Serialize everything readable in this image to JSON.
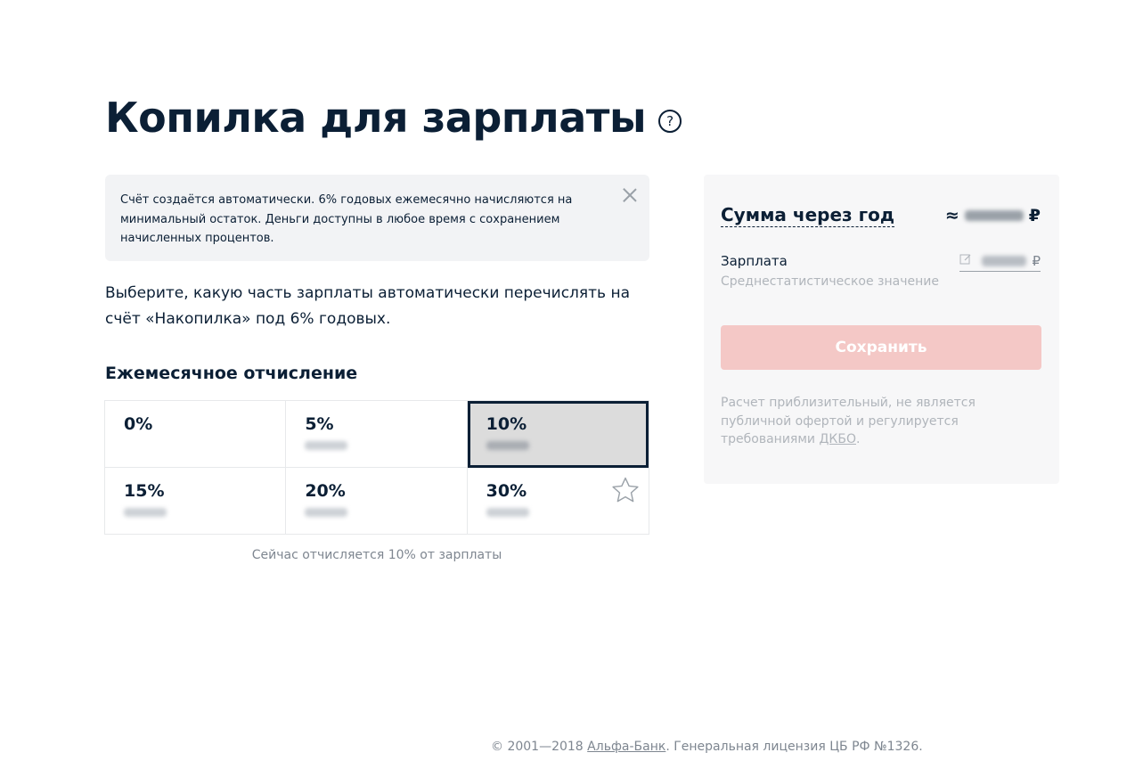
{
  "page": {
    "title": "Копилка для зарплаты",
    "help_icon": "question-circle-icon",
    "help_glyph": "?"
  },
  "notice": {
    "text": "Счёт создаётся автоматически. 6% годовых ежемесячно начисляются на минимальный остаток. Деньги доступны в любое время с сохранением начисленных процентов.",
    "close_icon": "close-icon"
  },
  "lead": "Выберите, какую часть зарплаты автоматически перечислять на счёт «Накопилка» под 6% годовых.",
  "deduction": {
    "heading": "Ежемесячное отчисление",
    "options": [
      {
        "label": "0%",
        "selected": false
      },
      {
        "label": "5%",
        "selected": false
      },
      {
        "label": "10%",
        "selected": true
      },
      {
        "label": "15%",
        "selected": false
      },
      {
        "label": "20%",
        "selected": false
      },
      {
        "label": "30%",
        "selected": false,
        "icon": "star-icon"
      }
    ],
    "current": "Сейчас отчисляется 10% от зарплаты"
  },
  "summary": {
    "title": "Сумма через год",
    "approx_sign": "≈",
    "currency": "₽",
    "salary_label": "Зарплата",
    "salary_hint": "Среднестатистическое значение",
    "salary_edit_icon": "edit-icon",
    "save_label": "Сохранить",
    "disclaimer": "Расчет приблизительный, не является публичной офертой и регулируется требованиями ",
    "disclaimer_link": "ДКБО",
    "disclaimer_end": "."
  },
  "footer": {
    "prefix": "© 2001—2018 ",
    "link": "Альфа-Банк",
    "suffix": ". Генеральная лицензия ЦБ РФ №1326."
  },
  "colors": {
    "text": "#0b1f35",
    "muted": "#7e8690",
    "save_disabled": "#f4c8c6",
    "notice_bg": "#f2f3f5",
    "card_bg": "#f7f7f8"
  }
}
